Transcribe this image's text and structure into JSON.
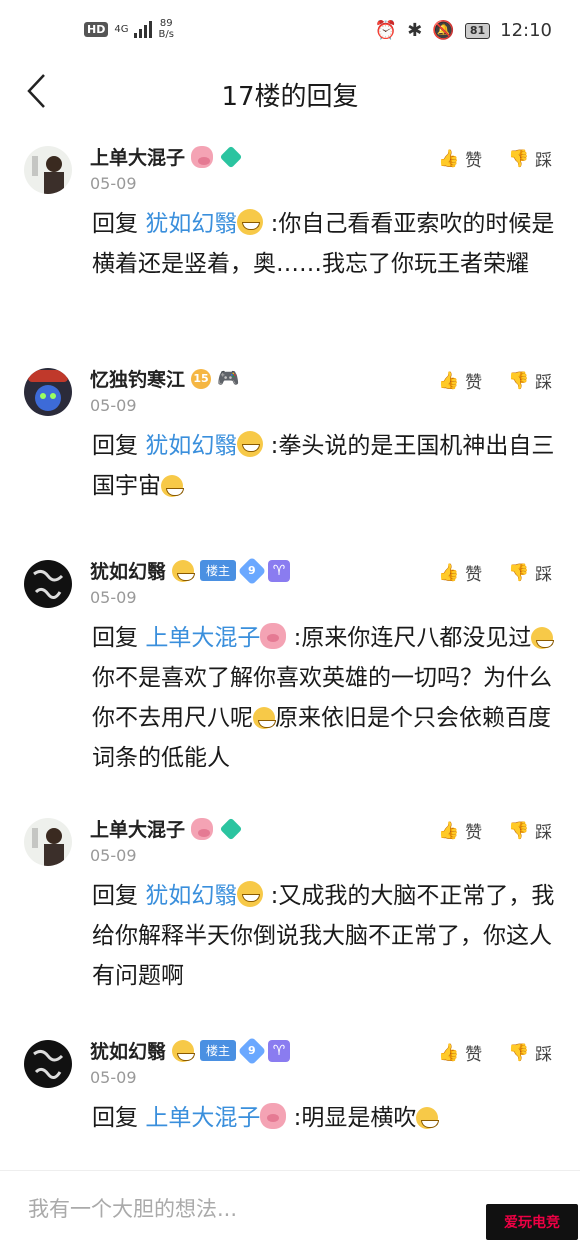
{
  "status_bar": {
    "left_badge": "HD",
    "network": "4G",
    "speed_value": "89",
    "speed_unit": "B/s",
    "battery": "81",
    "time": "12:10"
  },
  "header": {
    "title": "17楼的回复"
  },
  "posts": [
    {
      "username": "上单大混子",
      "date": "05-09",
      "like_label": "赞",
      "dislike_label": "踩",
      "reply_prefix": "回复",
      "mention": "犹如幻翳",
      "text": ":你自己看看亚索吹的时候是横着还是竖着，奥……我忘了你玩王者荣耀"
    },
    {
      "username": "忆独钓寒江",
      "level": "15",
      "date": "05-09",
      "like_label": "赞",
      "dislike_label": "踩",
      "reply_prefix": "回复",
      "mention": "犹如幻翳",
      "text": ":拳头说的是王国机神出自三国宇宙"
    },
    {
      "username": "犹如幻翳",
      "badge": "楼主",
      "level": "9",
      "date": "05-09",
      "like_label": "赞",
      "dislike_label": "踩",
      "reply_prefix": "回复",
      "mention": "上单大混子",
      "text_a": ":原来你连尺八都没见过",
      "text_b": "你不是喜欢了解你喜欢英雄的一切吗？为什么你不去用尺八呢",
      "text_c": "原来依旧是个只会依赖百度词条的低能人"
    },
    {
      "username": "上单大混子",
      "date": "05-09",
      "like_label": "赞",
      "dislike_label": "踩",
      "reply_prefix": "回复",
      "mention": "犹如幻翳",
      "text": ":又成我的大脑不正常了，我给你解释半天你倒说我大脑不正常了，你这人有问题啊"
    },
    {
      "username": "犹如幻翳",
      "badge": "楼主",
      "level": "9",
      "date": "05-09",
      "like_label": "赞",
      "dislike_label": "踩",
      "reply_prefix": "回复",
      "mention": "上单大混子",
      "text": ":明显是横吹"
    }
  ],
  "reply_box": {
    "placeholder": "我有一个大胆的想法..."
  },
  "watermark": "爱玩电竞"
}
